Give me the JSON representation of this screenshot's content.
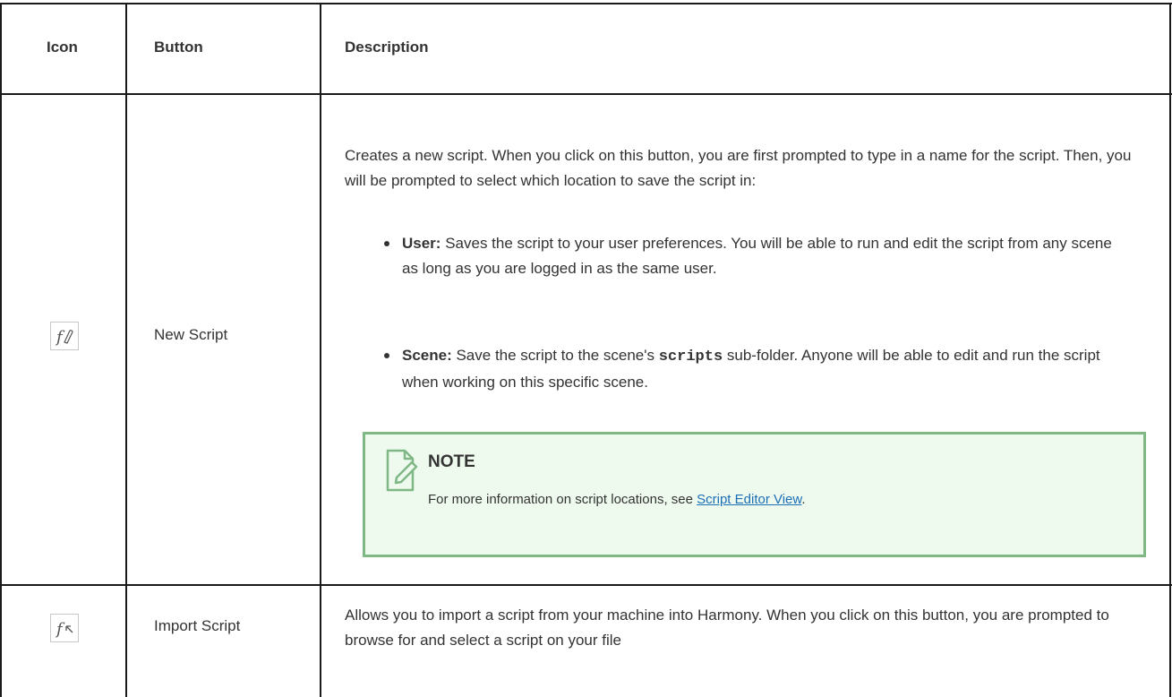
{
  "table": {
    "headers": {
      "icon": "Icon",
      "button": "Button",
      "description": "Description"
    },
    "rows": [
      {
        "icon_name": "new-script-icon",
        "button": "New Script",
        "description": "Creates a new script. When you click on this button, you are first prompted to type in a name for the script. Then, you will be prompted to select which location to save the script in:",
        "bullets": [
          {
            "label": "User:",
            "text": " Saves the script to your user preferences. You will be able to run and edit the script from any scene as long as you are logged in as the same user."
          },
          {
            "label": "Scene:",
            "text_before": " Save the script to the scene's ",
            "code": "scripts",
            "text_after": " sub-folder. Anyone will be able to edit and run the script when working on this specific scene."
          }
        ],
        "note": {
          "icon_name": "note-pencil-icon",
          "title": "NOTE",
          "body": "For more information on script locations, see ",
          "link": "Script Editor View",
          "period": "."
        }
      },
      {
        "icon_name": "import-script-icon",
        "button": "Import Script",
        "description": "Allows you to import a script from your machine into Harmony. When you click on this button, you are prompted to browse for and select a script on your file"
      }
    ]
  },
  "colors": {
    "border": "#1a1a1a",
    "note_bg": "#effaef",
    "note_border": "#7fb785",
    "link": "#1b6fb5"
  }
}
